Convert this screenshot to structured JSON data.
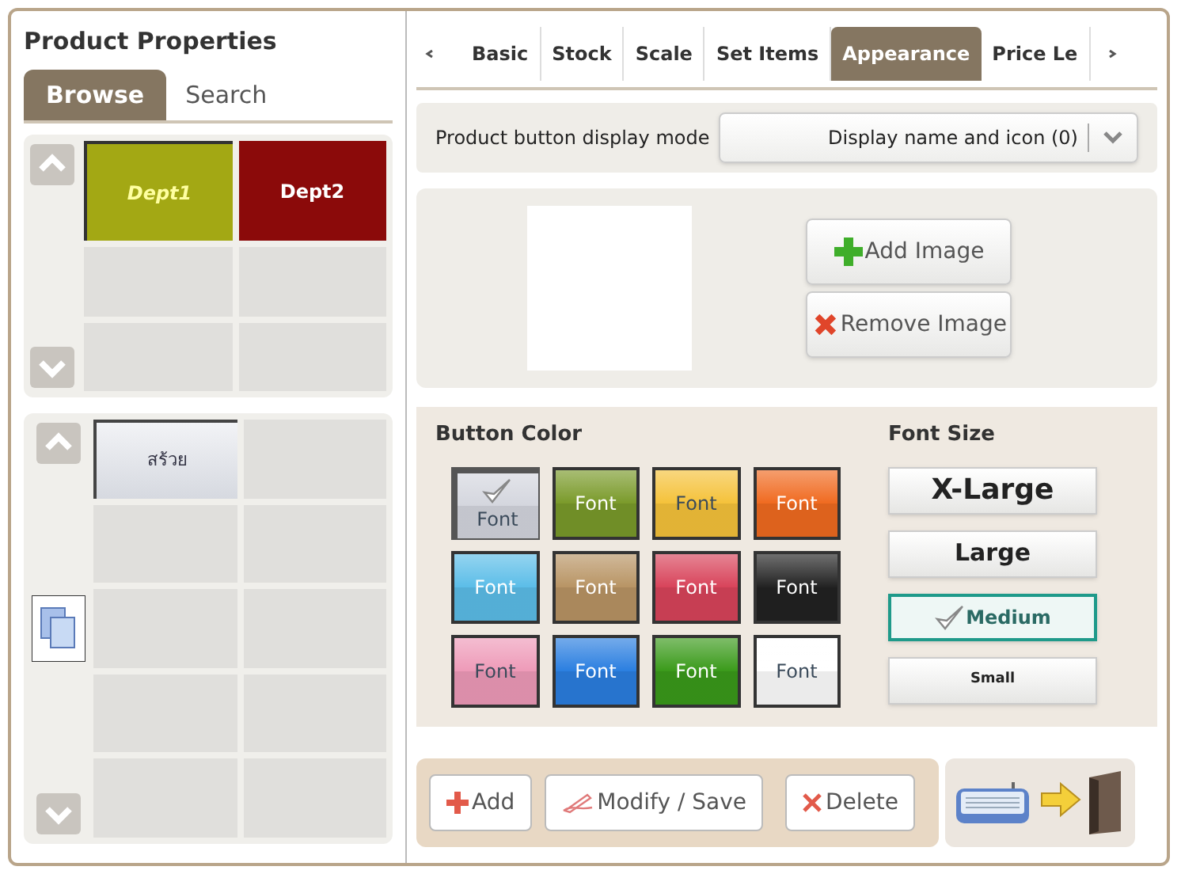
{
  "title": "Product Properties",
  "browse_tabs": [
    {
      "label": "Browse",
      "selected": true
    },
    {
      "label": "Search",
      "selected": false
    }
  ],
  "department_cells": [
    {
      "label": "Dept1",
      "color": "#a3a814",
      "selected": true
    },
    {
      "label": "Dept2",
      "color": "#8b0a0a",
      "selected": false
    }
  ],
  "product_cells": [
    {
      "label": "สร้วย",
      "selected": true
    }
  ],
  "property_tabs": [
    {
      "label": "Basic",
      "selected": false
    },
    {
      "label": "Stock",
      "selected": false
    },
    {
      "label": "Scale",
      "selected": false
    },
    {
      "label": "Set Items",
      "selected": false
    },
    {
      "label": "Appearance",
      "selected": true
    },
    {
      "label": "Price Le",
      "selected": false
    }
  ],
  "display_mode": {
    "label": "Product button display mode",
    "value": "Display name and icon (0)"
  },
  "image_buttons": [
    {
      "label": "Add Image",
      "kind": "add"
    },
    {
      "label": "Remove Image",
      "kind": "remove"
    }
  ],
  "button_color": {
    "heading": "Button Color",
    "swatches": [
      {
        "label": "Font",
        "color": "#d4d6de",
        "selected": true
      },
      {
        "label": "Font",
        "color": "#7a9a2a",
        "selected": false
      },
      {
        "label": "Font",
        "color": "#f5c23a",
        "selected": false
      },
      {
        "label": "Font",
        "color": "#f06a20",
        "selected": false
      },
      {
        "label": "Font",
        "color": "#5bbde8",
        "selected": false
      },
      {
        "label": "Font",
        "color": "#b89464",
        "selected": false
      },
      {
        "label": "Font",
        "color": "#d8435a",
        "selected": false
      },
      {
        "label": "Font",
        "color": "#222222",
        "selected": false
      },
      {
        "label": "Font",
        "color": "#ee9ab8",
        "selected": false
      },
      {
        "label": "Font",
        "color": "#2a7ee0",
        "selected": false
      },
      {
        "label": "Font",
        "color": "#3a9a1a",
        "selected": false
      },
      {
        "label": "Font",
        "color": "#ffffff",
        "selected": false
      }
    ]
  },
  "font_size": {
    "heading": "Font Size",
    "options": [
      {
        "label": "X-Large",
        "kind": "xlarge",
        "selected": false
      },
      {
        "label": "Large",
        "kind": "large",
        "selected": false
      },
      {
        "label": "Medium",
        "kind": "medium",
        "selected": true
      },
      {
        "label": "Small",
        "kind": "small",
        "selected": false
      }
    ]
  },
  "actions": [
    {
      "label": "Add",
      "kind": "add"
    },
    {
      "label": "Modify / Save",
      "kind": "modify"
    },
    {
      "label": "Delete",
      "kind": "delete"
    }
  ]
}
